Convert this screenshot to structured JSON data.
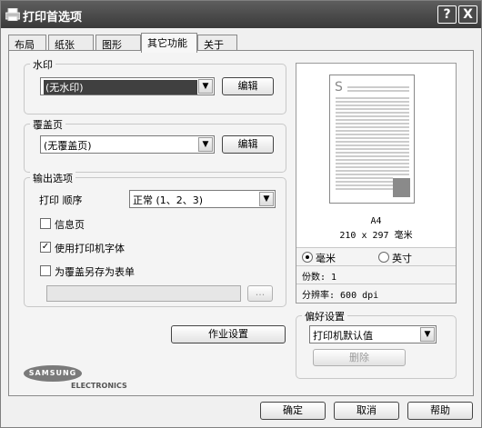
{
  "window": {
    "title": "打印首选项",
    "help_button": "?",
    "close_button": "X"
  },
  "tabs": [
    {
      "label": "布局"
    },
    {
      "label": "纸张"
    },
    {
      "label": "图形"
    },
    {
      "label": "其它功能",
      "active": true
    },
    {
      "label": "关于"
    }
  ],
  "watermark": {
    "group_label": "水印",
    "selected": "(无水印)",
    "edit_label": "编辑"
  },
  "overlay": {
    "group_label": "覆盖页",
    "selected": "(无覆盖页)",
    "edit_label": "编辑"
  },
  "output": {
    "group_label": "输出选项",
    "print_order_label": "打印 顺序",
    "print_order_value": "正常 (1、2、3)",
    "checkboxes": [
      {
        "label": "信息页",
        "checked": false
      },
      {
        "label": "使用打印机字体",
        "checked": true
      },
      {
        "label": "为覆盖另存为表单",
        "checked": false
      }
    ],
    "path_value": "",
    "browse_label": "..."
  },
  "job_settings_label": "作业设置",
  "preview": {
    "paper_name": "A4",
    "paper_size": "210 x 297 毫米",
    "units": [
      {
        "label": "毫米",
        "selected": true
      },
      {
        "label": "英寸",
        "selected": false
      }
    ],
    "copies": "份数: 1",
    "resolution": "分辨率: 600 dpi"
  },
  "favorites": {
    "group_label": "偏好设置",
    "selected": "打印机默认值",
    "delete_label": "删除"
  },
  "logo": {
    "brand": "SAMSUNG",
    "sub": "ELECTRONICS"
  },
  "buttons": {
    "ok": "确定",
    "cancel": "取消",
    "help": "帮助"
  },
  "colors": {
    "titlebar": "#4a4a4a",
    "panel": "#f4f4f4",
    "selection": "#404040"
  }
}
